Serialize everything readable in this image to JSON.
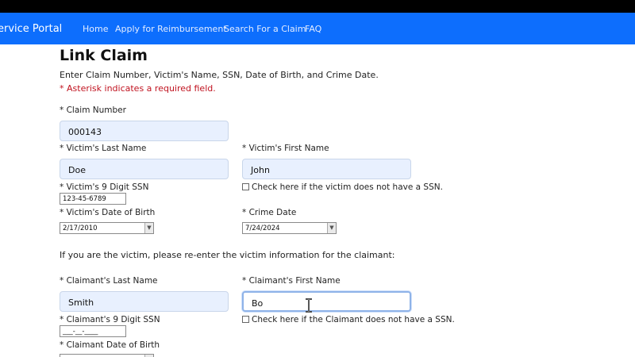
{
  "nav": {
    "brand": "ervice Portal",
    "links": [
      "Home",
      "Apply for Reimbursement",
      "Search For a Claim",
      "FAQ"
    ]
  },
  "page": {
    "title": "Link Claim",
    "instructions": "Enter Claim Number, Victim's Name, SSN, Date of Birth, and Crime Date.",
    "required_note": "* Asterisk indicates a required field.",
    "reenter_note": "If you are the victim, please re-enter the victim information for the claimant:"
  },
  "victim": {
    "claim_number_label": "* Claim Number",
    "claim_number_value": "000143",
    "last_name_label": "* Victim's Last Name",
    "last_name_value": "Doe",
    "first_name_label": "* Victim's First Name",
    "first_name_value": "John",
    "ssn_label": "* Victim's 9 Digit SSN",
    "ssn_value": "123-45-6789",
    "no_ssn_label": "Check here if the victim does not have a SSN.",
    "dob_label": "* Victim's Date of Birth",
    "dob_value": "2/17/2010",
    "crime_date_label": "* Crime Date",
    "crime_date_value": "7/24/2024"
  },
  "claimant": {
    "last_name_label": "* Claimant's Last Name",
    "last_name_value": "Smith",
    "first_name_label": "* Claimant's First Name",
    "first_name_value": "Bo",
    "ssn_label": "* Claimant's 9 Digit SSN",
    "ssn_placeholder": "___-__-____",
    "no_ssn_label": "Check here if the Claimant does not have a SSN.",
    "dob_label": "* Claimant Date of Birth"
  },
  "colors": {
    "navbar": "#0d6efd",
    "required": "#c0121f",
    "field_fill": "#e8f0fe"
  }
}
